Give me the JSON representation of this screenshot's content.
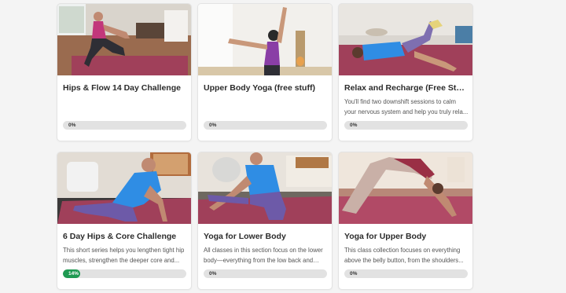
{
  "courses": [
    {
      "title": "Hips & Flow 14 Day Challenge",
      "description": "",
      "progress_label": "0%",
      "progress": 0,
      "image": "woman-lunge-stretch-living-room"
    },
    {
      "title": "Upper Body Yoga (free stuff)",
      "description": "",
      "progress_label": "0%",
      "progress": 0,
      "image": "woman-arm-stretch-at-wall"
    },
    {
      "title": "Relax and Recharge (Free Stuff)",
      "description": "You'll find two downshift sessions to calm your nervous system and help you truly rela...",
      "progress_label": "0%",
      "progress": 0,
      "image": "woman-reclined-leg-stretch"
    },
    {
      "title": "6 Day Hips & Core Challenge",
      "description": "This short series helps you lengthen tight hip muscles, strengthen the deeper core and...",
      "progress_label": "14%",
      "progress": 14,
      "image": "woman-pigeon-pose"
    },
    {
      "title": "Yoga for Lower Body",
      "description": "All classes in this section focus on the lower body—everything from the low back and hip...",
      "progress_label": "0%",
      "progress": 0,
      "image": "woman-seated-twist-stretch"
    },
    {
      "title": "Yoga for Upper Body",
      "description": "This class collection focuses on everything above the belly button, from the shoulders...",
      "progress_label": "0%",
      "progress": 0,
      "image": "woman-downward-dog"
    }
  ],
  "colors": {
    "progress_fill": "#1f9a52",
    "progress_track": "#e2e2e2",
    "mat": "#a0405a"
  }
}
